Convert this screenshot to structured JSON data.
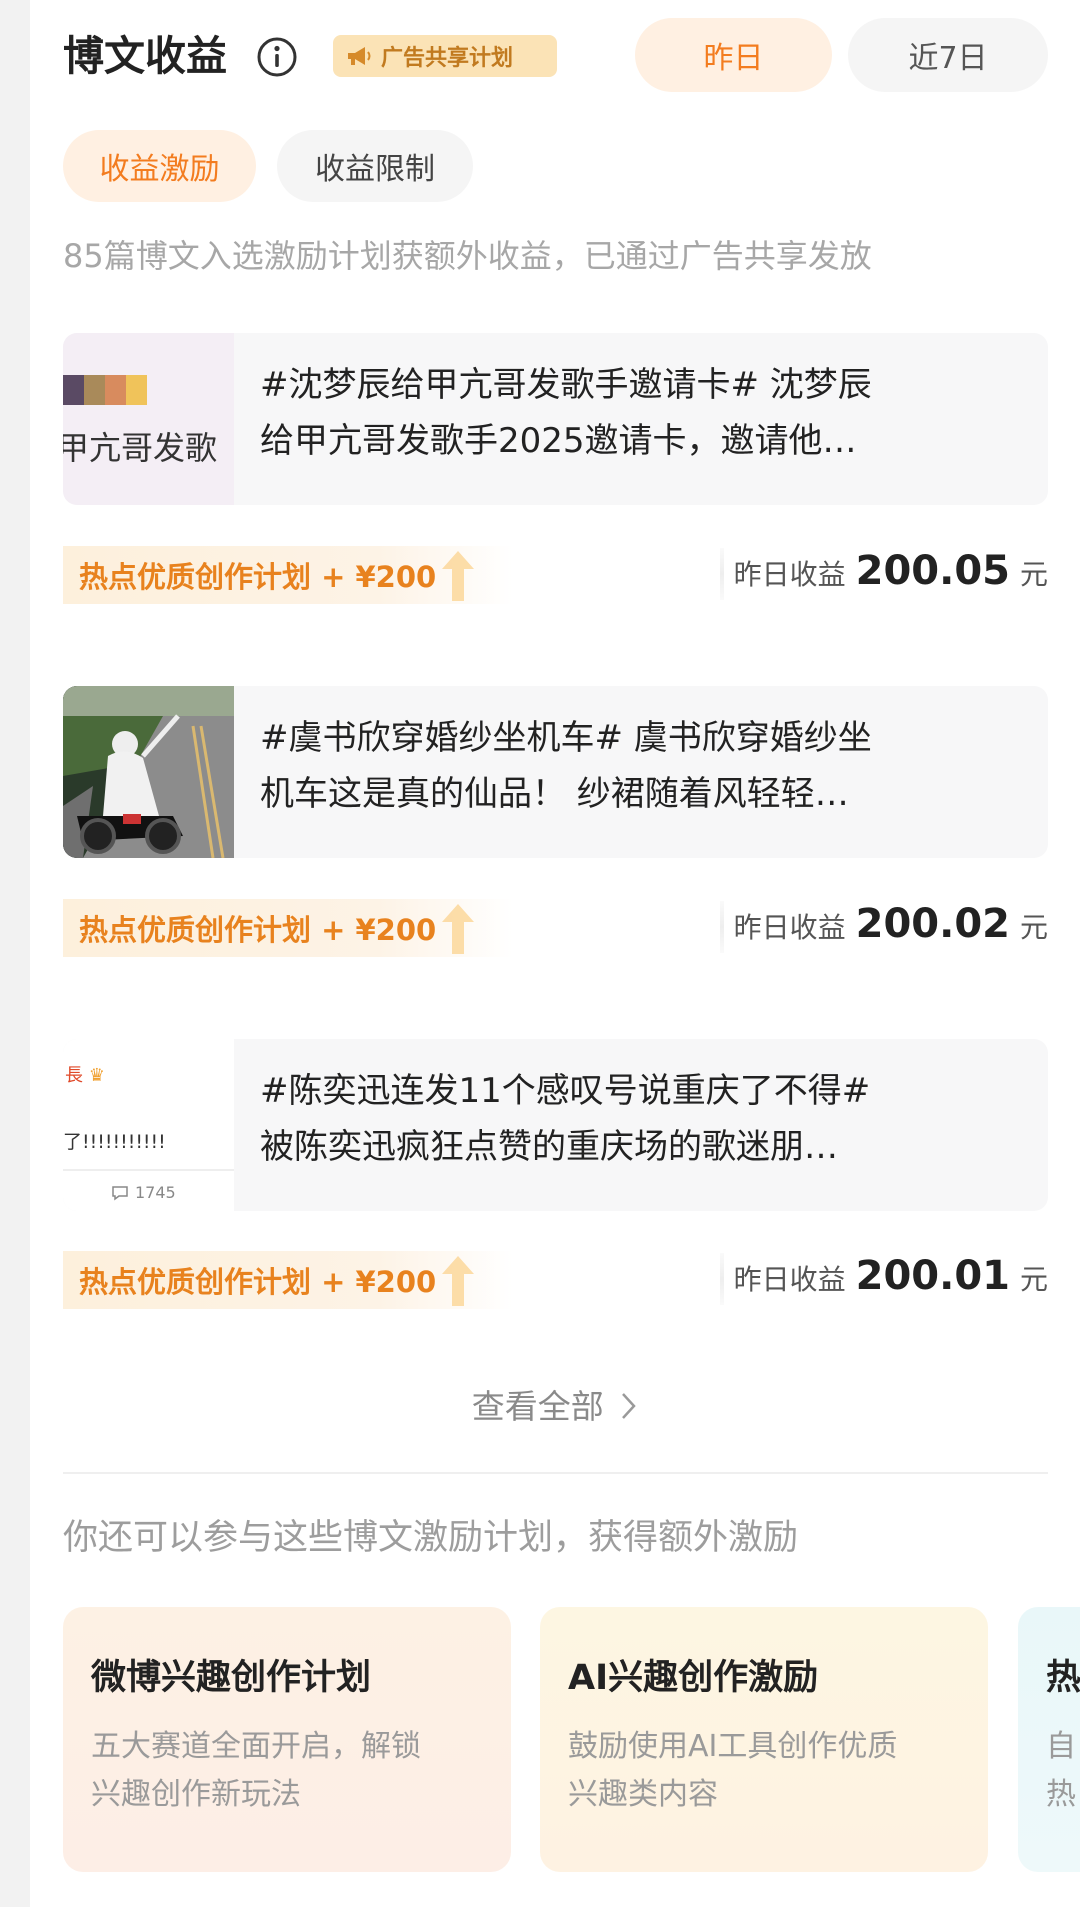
{
  "header": {
    "title": "博文收益",
    "ad_badge": "广告共享计划",
    "period_tabs": [
      "昨日",
      "近7日"
    ],
    "active_period": "昨日"
  },
  "sub_tabs": [
    "收益激励",
    "收益限制"
  ],
  "active_sub_tab": "收益激励",
  "summary": "85篇博文入选激励计划获额外收益，已通过广告共享发放",
  "posts": [
    {
      "thumb_text": "甲亢哥发歌",
      "line1": "#沈梦辰给甲亢哥发歌手邀请卡# 沈梦辰",
      "line2": "给甲亢哥发歌手2025邀请卡，邀请他…",
      "plan": "热点优质创作计划 + ¥200",
      "earn_label": "昨日收益",
      "earn_amount": "200.05",
      "earn_unit": "元"
    },
    {
      "thumb_text": "",
      "line1": "#虞书欣穿婚纱坐机车# 虞书欣穿婚纱坐",
      "line2": "机车这是真的仙品！ 纱裙随着风轻轻…",
      "plan": "热点优质创作计划 + ¥200",
      "earn_label": "昨日收益",
      "earn_amount": "200.02",
      "earn_unit": "元"
    },
    {
      "thumb_text": "了!!!!!!!!!!!",
      "thumb_top": "長",
      "thumb_count": "1745",
      "line1": "#陈奕迅连发11个感叹号说重庆了不得#",
      "line2": "被陈奕迅疯狂点赞的重庆场的歌迷朋…",
      "plan": "热点优质创作计划 + ¥200",
      "earn_label": "昨日收益",
      "earn_amount": "200.01",
      "earn_unit": "元"
    }
  ],
  "view_all": "查看全部",
  "more_intro": "你还可以参与这些博文激励计划，获得额外激励",
  "plan_cards": [
    {
      "title": "微博兴趣创作计划",
      "desc1": "五大赛道全面开启，解锁",
      "desc2": "兴趣创作新玩法"
    },
    {
      "title": "AI兴趣创作激励",
      "desc1": "鼓励使用AI工具创作优质",
      "desc2": "兴趣类内容"
    },
    {
      "title": "热",
      "desc1": "自",
      "desc2": "热"
    }
  ],
  "colors": {
    "accent": "#f37c1f",
    "tag_text": "#e8821e",
    "badge_bg": "#fbe3b6"
  }
}
